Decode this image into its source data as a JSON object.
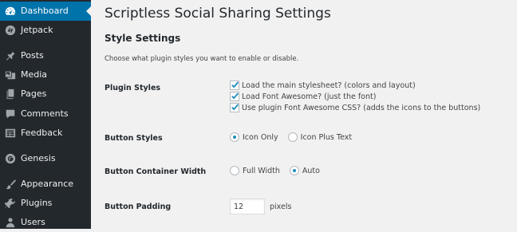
{
  "sidebar": {
    "items": [
      {
        "label": "Dashboard",
        "icon": "dashboard-icon",
        "active": true
      },
      {
        "label": "Jetpack",
        "icon": "jetpack-icon"
      },
      {
        "label": "Posts",
        "icon": "pushpin-icon"
      },
      {
        "label": "Media",
        "icon": "media-icon"
      },
      {
        "label": "Pages",
        "icon": "pages-icon"
      },
      {
        "label": "Comments",
        "icon": "comments-icon"
      },
      {
        "label": "Feedback",
        "icon": "feedback-icon"
      },
      {
        "label": "Genesis",
        "icon": "genesis-icon"
      },
      {
        "label": "Appearance",
        "icon": "appearance-icon"
      },
      {
        "label": "Plugins",
        "icon": "plugins-icon"
      },
      {
        "label": "Users",
        "icon": "users-icon"
      }
    ],
    "colors": {
      "background": "#23282d",
      "active": "#0073aa",
      "icon": "#a0a5aa"
    }
  },
  "main": {
    "title": "Scriptless Social Sharing Settings",
    "section_title": "Style Settings",
    "section_desc": "Choose what plugin styles you want to enable or disable.",
    "plugin_styles": {
      "label": "Plugin Styles",
      "options": [
        {
          "label": "Load the main stylesheet? (colors and layout)",
          "checked": true
        },
        {
          "label": "Load Font Awesome? (just the font)",
          "checked": true
        },
        {
          "label": "Use plugin Font Awesome CSS? (adds the icons to the buttons)",
          "checked": true
        }
      ]
    },
    "button_styles": {
      "label": "Button Styles",
      "options": [
        {
          "label": "Icon Only",
          "selected": true
        },
        {
          "label": "Icon Plus Text",
          "selected": false
        }
      ]
    },
    "button_container_width": {
      "label": "Button Container Width",
      "options": [
        {
          "label": "Full Width",
          "selected": false
        },
        {
          "label": "Auto",
          "selected": true
        }
      ]
    },
    "button_padding": {
      "label": "Button Padding",
      "value": "12",
      "unit": "pixels"
    },
    "colors": {
      "checkmark": "#1e8cbe",
      "radio_dot": "#1e8cbe"
    }
  }
}
